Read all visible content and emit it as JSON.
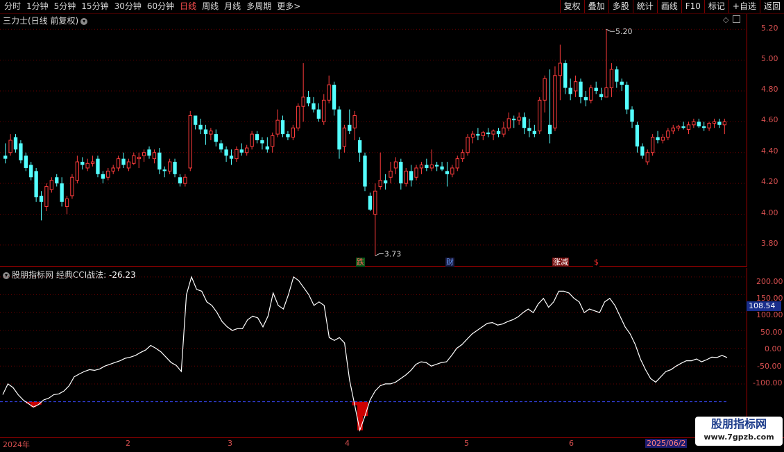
{
  "toolbar": {
    "periods": [
      "分时",
      "1分钟",
      "5分钟",
      "15分钟",
      "30分钟",
      "60分钟",
      "日线",
      "周线",
      "月线",
      "多周期",
      "更多>"
    ],
    "active_period": "日线",
    "buttons": [
      "复权",
      "叠加",
      "多股",
      "统计",
      "画线",
      "F10",
      "标记",
      "+自选",
      "返回"
    ]
  },
  "price_panel": {
    "title": "三力士(日线 前复权)",
    "y_ticks": [
      "5.20",
      "5.00",
      "4.80",
      "4.60",
      "4.40",
      "4.20",
      "4.00",
      "3.80"
    ],
    "high_label": "5.20",
    "low_label": "3.73",
    "events": [
      {
        "text": "跌",
        "color": "#ff5a5a",
        "bg": "#0a5a1a"
      },
      {
        "text": "财",
        "color": "#6aa0ff",
        "bg": "#1a1a40"
      },
      {
        "text": "涨减",
        "color": "#ffffff",
        "bg": "#7a1010"
      },
      {
        "text": "$",
        "color": "#ff3030",
        "bg": "#000000"
      }
    ]
  },
  "indicator_panel": {
    "name": "股朋指标网",
    "indicator": "经典CCI战法:",
    "value": "-26.23",
    "y_ticks": [
      "200.00",
      "150.00",
      "100.00",
      "50.00",
      "0.00",
      "-50.00",
      "-100.00"
    ],
    "current_badge": "108.54"
  },
  "date_axis": {
    "labels": [
      "2024年",
      "2",
      "3",
      "4",
      "5",
      "6"
    ],
    "current_date": "2025/06/2"
  },
  "watermark": {
    "name": "股朋指标网",
    "url": "www.7gpzb.com"
  },
  "colors": {
    "up": "#ff3c3c",
    "down": "#54ffff",
    "axis": "#a00000",
    "grid": "#6a0000",
    "cci_line": "#ffffff",
    "threshold": "#3a4aff",
    "bar": "#cc0000"
  },
  "chart_data": [
    {
      "type": "candlestick",
      "title": "三力士(日线 前复权)",
      "ylim": [
        3.66,
        5.3
      ],
      "grid": true,
      "ohlc": [
        [
          4.38,
          4.46,
          4.33,
          4.36
        ],
        [
          4.4,
          4.52,
          4.38,
          4.48
        ],
        [
          4.5,
          4.52,
          4.4,
          4.42
        ],
        [
          4.46,
          4.48,
          4.33,
          4.35
        ],
        [
          4.38,
          4.4,
          4.28,
          4.3
        ],
        [
          4.32,
          4.34,
          4.22,
          4.24
        ],
        [
          4.28,
          4.3,
          4.08,
          4.11
        ],
        [
          4.12,
          4.15,
          3.96,
          4.08
        ],
        [
          4.05,
          4.2,
          4.02,
          4.18
        ],
        [
          4.16,
          4.24,
          4.14,
          4.22
        ],
        [
          4.24,
          4.26,
          4.18,
          4.2
        ],
        [
          4.2,
          4.24,
          4.05,
          4.08
        ],
        [
          4.05,
          4.12,
          4.0,
          4.1
        ],
        [
          4.12,
          4.26,
          4.1,
          4.24
        ],
        [
          4.22,
          4.38,
          4.2,
          4.34
        ],
        [
          4.34,
          4.37,
          4.29,
          4.32
        ],
        [
          4.3,
          4.36,
          4.28,
          4.33
        ],
        [
          4.33,
          4.38,
          4.31,
          4.34
        ],
        [
          4.36,
          4.38,
          4.24,
          4.26
        ],
        [
          4.26,
          4.28,
          4.2,
          4.23
        ],
        [
          4.24,
          4.3,
          4.22,
          4.28
        ],
        [
          4.28,
          4.32,
          4.26,
          4.3
        ],
        [
          4.3,
          4.38,
          4.28,
          4.36
        ],
        [
          4.36,
          4.4,
          4.3,
          4.32
        ],
        [
          4.3,
          4.36,
          4.28,
          4.34
        ],
        [
          4.33,
          4.4,
          4.32,
          4.38
        ],
        [
          4.36,
          4.4,
          4.3,
          4.37
        ],
        [
          4.38,
          4.42,
          4.34,
          4.4
        ],
        [
          4.42,
          4.44,
          4.36,
          4.38
        ],
        [
          4.36,
          4.42,
          4.33,
          4.4
        ],
        [
          4.4,
          4.43,
          4.26,
          4.29
        ],
        [
          4.29,
          4.31,
          4.24,
          4.28
        ],
        [
          4.28,
          4.36,
          4.26,
          4.34
        ],
        [
          4.34,
          4.36,
          4.24,
          4.26
        ],
        [
          4.24,
          4.26,
          4.18,
          4.2
        ],
        [
          4.2,
          4.26,
          4.18,
          4.24
        ],
        [
          4.3,
          4.67,
          4.28,
          4.64
        ],
        [
          4.64,
          4.62,
          4.55,
          4.58
        ],
        [
          4.58,
          4.62,
          4.52,
          4.55
        ],
        [
          4.55,
          4.58,
          4.45,
          4.52
        ],
        [
          4.52,
          4.56,
          4.48,
          4.54
        ],
        [
          4.52,
          4.55,
          4.44,
          4.47
        ],
        [
          4.46,
          4.48,
          4.4,
          4.42
        ],
        [
          4.42,
          4.44,
          4.34,
          4.38
        ],
        [
          4.38,
          4.42,
          4.32,
          4.36
        ],
        [
          4.36,
          4.44,
          4.34,
          4.42
        ],
        [
          4.42,
          4.46,
          4.38,
          4.4
        ],
        [
          4.4,
          4.45,
          4.38,
          4.43
        ],
        [
          4.44,
          4.54,
          4.42,
          4.52
        ],
        [
          4.52,
          4.54,
          4.46,
          4.48
        ],
        [
          4.48,
          4.5,
          4.42,
          4.46
        ],
        [
          4.44,
          4.5,
          4.4,
          4.42
        ],
        [
          4.44,
          4.53,
          4.4,
          4.51
        ],
        [
          4.52,
          4.68,
          4.5,
          4.61
        ],
        [
          4.61,
          4.64,
          4.5,
          4.52
        ],
        [
          4.52,
          4.54,
          4.48,
          4.5
        ],
        [
          4.5,
          4.58,
          4.48,
          4.56
        ],
        [
          4.56,
          4.72,
          4.54,
          4.7
        ],
        [
          4.7,
          4.98,
          4.6,
          4.76
        ],
        [
          4.76,
          4.8,
          4.7,
          4.72
        ],
        [
          4.72,
          4.76,
          4.66,
          4.68
        ],
        [
          4.68,
          4.72,
          4.6,
          4.62
        ],
        [
          4.6,
          4.78,
          4.58,
          4.74
        ],
        [
          4.74,
          4.9,
          4.72,
          4.84
        ],
        [
          4.84,
          4.86,
          4.64,
          4.68
        ],
        [
          4.68,
          4.7,
          4.36,
          4.42
        ],
        [
          4.44,
          4.58,
          4.4,
          4.56
        ],
        [
          4.58,
          4.68,
          4.52,
          4.54
        ],
        [
          4.56,
          4.67,
          4.48,
          4.64
        ],
        [
          4.48,
          4.5,
          4.34,
          4.4
        ],
        [
          4.38,
          4.4,
          4.15,
          4.18
        ],
        [
          4.12,
          4.14,
          4.02,
          4.03
        ],
        [
          4.0,
          4.2,
          3.73,
          4.15
        ],
        [
          4.18,
          4.4,
          4.16,
          4.22
        ],
        [
          4.22,
          4.26,
          4.16,
          4.2
        ],
        [
          4.24,
          4.34,
          4.2,
          4.28
        ],
        [
          4.3,
          4.37,
          4.26,
          4.34
        ],
        [
          4.34,
          4.36,
          4.16,
          4.2
        ],
        [
          4.2,
          4.3,
          4.18,
          4.28
        ],
        [
          4.28,
          4.32,
          4.18,
          4.22
        ],
        [
          4.24,
          4.32,
          4.22,
          4.3
        ],
        [
          4.3,
          4.34,
          4.26,
          4.32
        ],
        [
          4.32,
          4.36,
          4.28,
          4.3
        ],
        [
          4.3,
          4.42,
          4.28,
          4.32
        ],
        [
          4.32,
          4.34,
          4.28,
          4.31
        ],
        [
          4.31,
          4.34,
          4.28,
          4.29
        ],
        [
          4.28,
          4.34,
          4.18,
          4.26
        ],
        [
          4.26,
          4.32,
          4.24,
          4.3
        ],
        [
          4.3,
          4.38,
          4.28,
          4.36
        ],
        [
          4.36,
          4.42,
          4.34,
          4.4
        ],
        [
          4.4,
          4.52,
          4.38,
          4.5
        ],
        [
          4.5,
          4.54,
          4.46,
          4.52
        ],
        [
          4.52,
          4.56,
          4.48,
          4.51
        ],
        [
          4.51,
          4.54,
          4.48,
          4.53
        ],
        [
          4.53,
          4.56,
          4.5,
          4.52
        ],
        [
          4.52,
          4.55,
          4.48,
          4.54
        ],
        [
          4.54,
          4.56,
          4.5,
          4.52
        ],
        [
          4.52,
          4.6,
          4.5,
          4.56
        ],
        [
          4.56,
          4.66,
          4.54,
          4.62
        ],
        [
          4.62,
          4.64,
          4.56,
          4.61
        ],
        [
          4.61,
          4.66,
          4.58,
          4.63
        ],
        [
          4.63,
          4.66,
          4.52,
          4.56
        ],
        [
          4.56,
          4.62,
          4.5,
          4.54
        ],
        [
          4.54,
          4.58,
          4.5,
          4.52
        ],
        [
          4.54,
          4.76,
          4.52,
          4.74
        ],
        [
          4.74,
          4.9,
          4.66,
          4.88
        ],
        [
          4.58,
          4.94,
          4.46,
          4.52
        ],
        [
          4.56,
          4.96,
          4.54,
          4.9
        ],
        [
          4.9,
          5.1,
          4.74,
          4.98
        ],
        [
          4.98,
          5.0,
          4.78,
          4.82
        ],
        [
          4.82,
          4.88,
          4.74,
          4.78
        ],
        [
          4.8,
          4.9,
          4.76,
          4.86
        ],
        [
          4.86,
          4.88,
          4.72,
          4.76
        ],
        [
          4.76,
          4.8,
          4.7,
          4.74
        ],
        [
          4.74,
          4.84,
          4.72,
          4.82
        ],
        [
          4.82,
          4.86,
          4.78,
          4.8
        ],
        [
          4.78,
          4.82,
          4.74,
          4.76
        ],
        [
          4.76,
          5.2,
          4.76,
          4.82
        ],
        [
          4.82,
          4.98,
          4.76,
          4.94
        ],
        [
          4.94,
          4.96,
          4.82,
          4.86
        ],
        [
          4.86,
          4.88,
          4.8,
          4.84
        ],
        [
          4.84,
          4.86,
          4.65,
          4.68
        ],
        [
          4.68,
          4.7,
          4.56,
          4.6
        ],
        [
          4.58,
          4.6,
          4.4,
          4.44
        ],
        [
          4.44,
          4.46,
          4.36,
          4.38
        ],
        [
          4.34,
          4.42,
          4.32,
          4.4
        ],
        [
          4.4,
          4.52,
          4.38,
          4.5
        ],
        [
          4.5,
          4.54,
          4.46,
          4.48
        ],
        [
          4.48,
          4.52,
          4.46,
          4.5
        ],
        [
          4.5,
          4.56,
          4.48,
          4.54
        ],
        [
          4.54,
          4.58,
          4.52,
          4.56
        ],
        [
          4.56,
          4.58,
          4.54,
          4.57
        ],
        [
          4.57,
          4.6,
          4.55,
          4.56
        ],
        [
          4.55,
          4.6,
          4.52,
          4.58
        ],
        [
          4.58,
          4.62,
          4.56,
          4.6
        ],
        [
          4.6,
          4.62,
          4.56,
          4.57
        ],
        [
          4.57,
          4.6,
          4.54,
          4.56
        ],
        [
          4.56,
          4.6,
          4.54,
          4.59
        ],
        [
          4.59,
          4.62,
          4.56,
          4.6
        ],
        [
          4.6,
          4.62,
          4.56,
          4.58
        ],
        [
          4.58,
          4.62,
          4.52,
          4.6
        ]
      ],
      "high_marker": {
        "value": 5.2,
        "label": "5.20"
      },
      "low_marker": {
        "value": 3.73,
        "label": "3.73"
      }
    },
    {
      "type": "line",
      "title": "经典CCI战法",
      "ylim": [
        -250,
        225
      ],
      "threshold": -150,
      "values": [
        -130,
        -100,
        -110,
        -130,
        -145,
        -155,
        -165,
        -158,
        -145,
        -140,
        -130,
        -128,
        -120,
        -105,
        -80,
        -72,
        -65,
        -60,
        -62,
        -58,
        -50,
        -45,
        -40,
        -35,
        -28,
        -25,
        -20,
        -12,
        -5,
        8,
        0,
        -10,
        -25,
        -40,
        -48,
        -65,
        150,
        200,
        165,
        160,
        130,
        120,
        100,
        75,
        60,
        50,
        55,
        55,
        80,
        90,
        85,
        60,
        90,
        155,
        120,
        110,
        150,
        200,
        190,
        170,
        150,
        120,
        130,
        120,
        30,
        22,
        30,
        15,
        -90,
        -160,
        -230,
        -190,
        -145,
        -120,
        -105,
        -100,
        -100,
        -95,
        -85,
        -75,
        -62,
        -45,
        -38,
        -40,
        -50,
        -45,
        -40,
        -38,
        -20,
        0,
        10,
        25,
        40,
        50,
        60,
        70,
        72,
        65,
        68,
        75,
        80,
        88,
        100,
        110,
        100,
        125,
        140,
        115,
        130,
        160,
        160,
        155,
        140,
        130,
        100,
        110,
        105,
        100,
        130,
        140,
        120,
        90,
        60,
        40,
        10,
        -30,
        -60,
        -85,
        -95,
        -80,
        -65,
        -60,
        -50,
        -42,
        -35,
        -35,
        -30,
        -38,
        -32,
        -25,
        -26,
        -20,
        -26
      ]
    }
  ]
}
